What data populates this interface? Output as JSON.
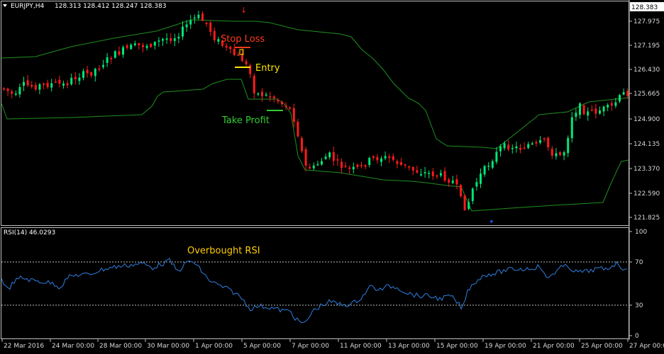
{
  "header": {
    "symbol_label": "EURJPY,H4",
    "ohlc": "128.313 128.412 128.247 128.383"
  },
  "price_scale": {
    "current_price": "128.383",
    "ticks": [
      "127.975",
      "127.195",
      "126.430",
      "125.665",
      "124.900",
      "124.135",
      "123.370",
      "122.590",
      "121.825"
    ]
  },
  "annotations": {
    "stop_loss": "Stop Loss",
    "entry": "Entry",
    "take_profit": "Take Profit",
    "overbought": "Overbought RSI"
  },
  "rsi": {
    "title": "RSI(14) 46.0293",
    "ticks": [
      "100",
      "70",
      "30",
      "0"
    ]
  },
  "time_axis": {
    "labels": [
      "22 Mar 2016",
      "24 Mar 00:00",
      "28 Mar 00:00",
      "30 Mar 00:00",
      "1 Apr 00:00",
      "5 Apr 00:00",
      "7 Apr 00:00",
      "11 Apr 00:00",
      "13 Apr 00:00",
      "15 Apr 00:00",
      "19 Apr 00:00",
      "21 Apr 00:00",
      "25 Apr 00:00",
      "27 Apr 00:00"
    ]
  },
  "colors": {
    "background": "#000000",
    "bull": "#00e676",
    "bear": "#ff1a1a",
    "channel": "#1f8f1f",
    "rsi_line": "#2f7fe0",
    "stop_loss": "#ff3c1a",
    "entry": "#ffe600",
    "take_profit": "#33cc33",
    "overbought": "#ffcc00",
    "grid": "#bfbfbf"
  },
  "chart_data": {
    "type": "candlestick",
    "symbol": "EURJPY",
    "timeframe": "H4",
    "x_range": [
      "22 Mar 2016",
      "27 Apr 00:00"
    ],
    "y_range": [
      121.825,
      127.975
    ],
    "rsi_period": 14,
    "rsi_last": 46.0293,
    "rsi_levels": [
      70,
      30
    ],
    "stop_loss_price": 127.1,
    "entry_price": 126.55,
    "take_profit_price": 125.2
  }
}
